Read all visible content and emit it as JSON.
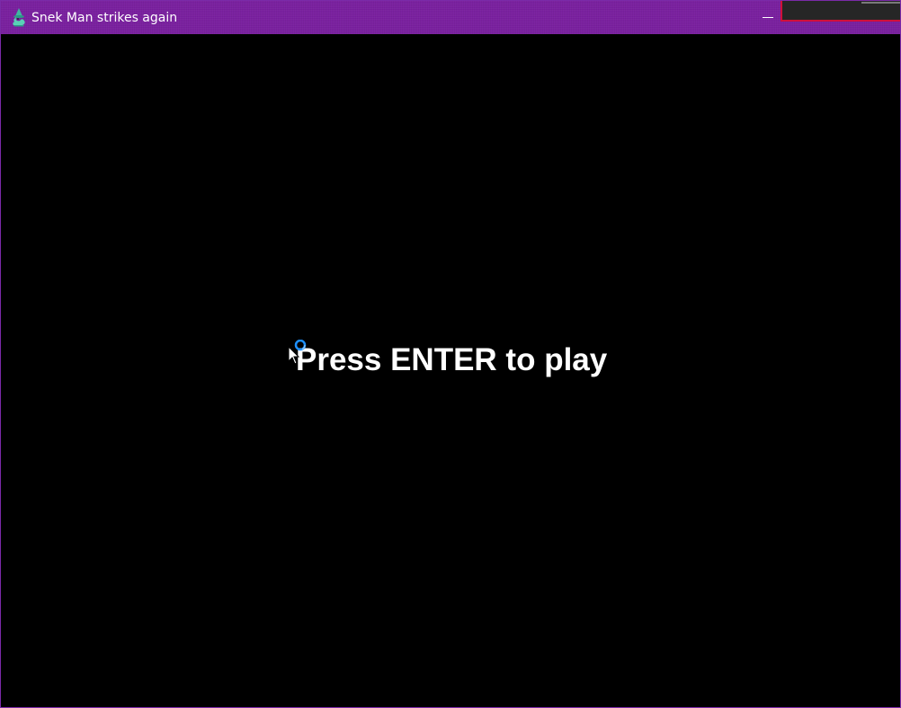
{
  "window": {
    "title": "Snek Man strikes again",
    "app_icon": "snake-wizard-icon",
    "titlebar_color": "#7a1fa0",
    "border_color": "#7a2aa8",
    "minimize_icon": "minimize-icon"
  },
  "game": {
    "background": "#000000",
    "prompt": "Press ENTER to play",
    "prompt_color": "#ffffff"
  },
  "cursor": {
    "icon": "busy-arrow-cursor-icon",
    "ring_color": "#1e90ff"
  },
  "overlay": {
    "border_color": "#d0103a",
    "fill_color": "#262626"
  }
}
